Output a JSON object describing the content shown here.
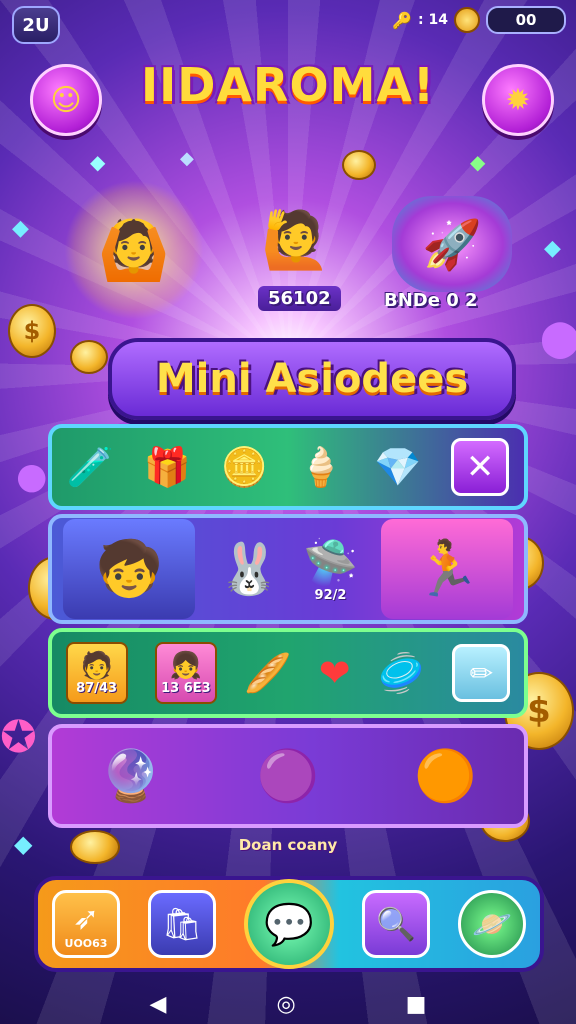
{
  "top_bar": {
    "level": "2U",
    "key_count": ": 14",
    "coins": "00"
  },
  "title": "IIDAROMA!",
  "heroes": [
    {
      "label": "",
      "icon": "boy-cheering"
    },
    {
      "label": "56102",
      "icon": "boy-waving"
    },
    {
      "label": "BNDe 0 2",
      "icon": "purple-spaceship"
    }
  ],
  "banner": {
    "text": "Mini Asiodees"
  },
  "rows": {
    "row1": {
      "items": [
        "potion-bottle",
        "gift-box",
        "gold-bars",
        "ice-cream",
        "crystal-gem"
      ]
    },
    "row2": {
      "price_label": "92/2"
    },
    "row3": {
      "card1_label": "87/43",
      "card2_label": "13 6E3"
    },
    "row4": {
      "items": [
        "pink-crystal-charm",
        "purple-orb-charm",
        "orange-orb-charm"
      ]
    }
  },
  "caption": "Doan coany",
  "nav": {
    "first_label": "UOO63"
  },
  "colors": {
    "accent_yellow": "#ffdc3c",
    "purple": "#7a1bb7",
    "green": "#2fbf7a",
    "orange": "#f59a1a"
  }
}
